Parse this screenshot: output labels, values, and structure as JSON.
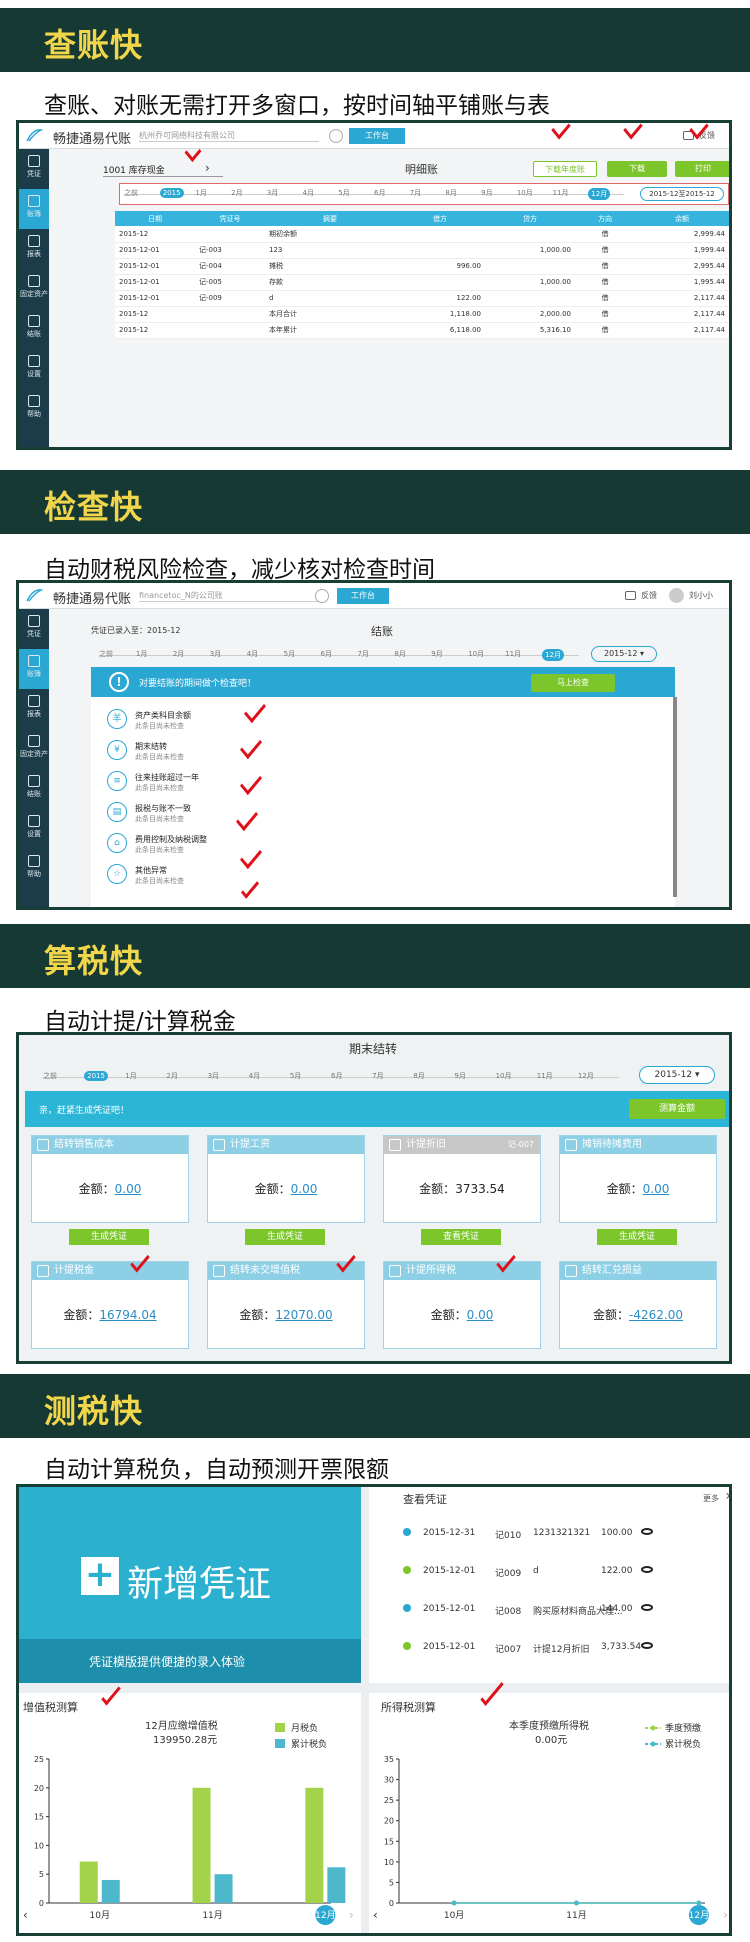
{
  "sections": [
    {
      "title": "查账快",
      "subtitle": "查账、对账无需打开多窗口，按时间轴平铺账与表"
    },
    {
      "title": "检查快",
      "subtitle": "自动财税风险检查，减少核对检查时间"
    },
    {
      "title": "算税快",
      "subtitle": "自动计提/计算税金"
    },
    {
      "title": "测税快",
      "subtitle": "自动计算税负，自动预测开票限额"
    }
  ],
  "app": {
    "brand": "畅捷通易代账",
    "company1": "杭州乔可网络科技有限公司",
    "company2": "financetoc_N的公司账",
    "workspace": "工作台",
    "feedback": "反馈",
    "user": "刘小小"
  },
  "sidebar": [
    "凭证",
    "账簿",
    "报表",
    "固定资产",
    "结账",
    "设置",
    "帮助"
  ],
  "ledger": {
    "account_code": "1001",
    "account_name": "库存现金",
    "title": "明细账",
    "btn_year": "下载年度账",
    "btn_download": "下载",
    "btn_print": "打印",
    "period": "2015-12至2015-12",
    "timeline": [
      "之前",
      "2015",
      "1月",
      "2月",
      "3月",
      "4月",
      "5月",
      "6月",
      "7月",
      "8月",
      "9月",
      "10月",
      "11月",
      "12月"
    ],
    "columns": [
      "日期",
      "凭证号",
      "摘要",
      "借方",
      "贷方",
      "方向",
      "余额"
    ],
    "rows": [
      [
        "2015-12",
        "",
        "期初余额",
        "",
        "",
        "借",
        "2,999.44"
      ],
      [
        "2015-12-01",
        "记-003",
        "123",
        "",
        "1,000.00",
        "借",
        "1,999.44"
      ],
      [
        "2015-12-01",
        "记-004",
        "摊税",
        "996.00",
        "",
        "借",
        "2,995.44"
      ],
      [
        "2015-12-01",
        "记-005",
        "存款",
        "",
        "1,000.00",
        "借",
        "1,995.44"
      ],
      [
        "2015-12-01",
        "记-009",
        "d",
        "122.00",
        "",
        "借",
        "2,117.44"
      ],
      [
        "2015-12",
        "",
        "本月合计",
        "1,118.00",
        "2,000.00",
        "借",
        "2,117.44"
      ],
      [
        "2015-12",
        "",
        "本年累计",
        "6,118.00",
        "5,316.10",
        "借",
        "2,117.44"
      ]
    ]
  },
  "closing": {
    "vouchers": "凭证已录入至：2015-12",
    "title": "结账",
    "period": "2015-12",
    "banner": "对要结账的期间做个检查吧！",
    "btn_check": "马上检查",
    "timeline": [
      "之前",
      "1月",
      "2月",
      "3月",
      "4月",
      "5月",
      "6月",
      "7月",
      "8月",
      "9月",
      "10月",
      "11月",
      "12月"
    ],
    "items": [
      {
        "icon": "羊",
        "name": "资产类科目余额",
        "status": "此条目尚未检查"
      },
      {
        "icon": "¥",
        "name": "期末结转",
        "status": "此条目尚未检查"
      },
      {
        "icon": "≡",
        "name": "往来挂账超过一年",
        "status": "此条目尚未检查"
      },
      {
        "icon": "▤",
        "name": "报税与账不一致",
        "status": "此条目尚未检查"
      },
      {
        "icon": "⌂",
        "name": "费用控制及纳税调整",
        "status": "此条目尚未检查"
      },
      {
        "icon": "☆",
        "name": "其他异常",
        "status": "此条目尚未检查"
      }
    ]
  },
  "period_end": {
    "title": "期末结转",
    "period": "2015-12",
    "banner": "亲，赶紧生成凭证吧！",
    "btn_calc": "测算金额",
    "timeline": [
      "之前",
      "2015",
      "1月",
      "2月",
      "3月",
      "4月",
      "5月",
      "6月",
      "7月",
      "8月",
      "9月",
      "10月",
      "11月",
      "12月"
    ],
    "cards_row1": [
      {
        "title": "结转销售成本",
        "amount_label": "金额：",
        "amount": "0.00",
        "btn": "生成凭证",
        "tag": ""
      },
      {
        "title": "计提工资",
        "amount_label": "金额：",
        "amount": "0.00",
        "btn": "生成凭证",
        "tag": ""
      },
      {
        "title": "计提折旧",
        "amount_label": "金额：",
        "amount": "3733.54",
        "btn": "查看凭证",
        "tag": "记-007"
      },
      {
        "title": "摊销待摊费用",
        "amount_label": "金额：",
        "amount": "0.00",
        "btn": "生成凭证",
        "tag": ""
      }
    ],
    "cards_row2": [
      {
        "title": "计提税金",
        "amount_label": "金额：",
        "amount": "16794.04"
      },
      {
        "title": "结转未交增值税",
        "amount_label": "金额：",
        "amount": "12070.00"
      },
      {
        "title": "计提所得税",
        "amount_label": "金额：",
        "amount": "0.00"
      },
      {
        "title": "结转汇兑损益",
        "amount_label": "金额：",
        "amount": "-4262.00"
      }
    ]
  },
  "dashboard": {
    "new_voucher": "新增凭证",
    "new_voucher_sub": "凭证模版提供便捷的录入体验",
    "view_vouchers": "查看凭证",
    "more": "更多",
    "vouchers": [
      {
        "date": "2015-12-31",
        "no": "记010",
        "desc": "1231321321",
        "amount": "100.00",
        "color": "#2aa8d3"
      },
      {
        "date": "2015-12-01",
        "no": "记009",
        "desc": "d",
        "amount": "122.00",
        "color": "#7cc62c"
      },
      {
        "date": "2015-12-01",
        "no": "记008",
        "desc": "购买原材料商品大理...",
        "amount": "144.00",
        "color": "#2aa8d3"
      },
      {
        "date": "2015-12-01",
        "no": "记007",
        "desc": "计提12月折旧",
        "amount": "3,733.54",
        "color": "#7cc62c"
      }
    ],
    "vat_title": "增值税测算",
    "vat_caption": "12月应缴增值税",
    "vat_amount": "139950.28元",
    "income_title": "所得税测算",
    "income_caption": "本季度预缴所得税",
    "income_amount": "0.00元"
  },
  "chart_data": [
    {
      "type": "bar",
      "title": "增值税测算",
      "categories": [
        "10月",
        "11月",
        "12月"
      ],
      "ylim": [
        0,
        25
      ],
      "yticks": [
        0,
        5,
        10,
        15,
        20,
        25
      ],
      "series": [
        {
          "name": "月税负",
          "color": "#a3d34b",
          "values": [
            7.2,
            20,
            20
          ]
        },
        {
          "name": "累计税负",
          "color": "#4db8cc",
          "values": [
            4,
            5,
            6.2
          ]
        }
      ]
    },
    {
      "type": "line",
      "title": "所得税测算",
      "categories": [
        "10月",
        "11月",
        "12月"
      ],
      "ylim": [
        0,
        35
      ],
      "yticks": [
        0,
        5,
        10,
        15,
        20,
        25,
        30,
        35
      ],
      "series": [
        {
          "name": "季度预缴",
          "color": "#a3d34b",
          "values": [
            0,
            0,
            0
          ]
        },
        {
          "name": "累计税负",
          "color": "#4db8cc",
          "values": [
            0,
            0,
            0
          ]
        }
      ]
    }
  ]
}
